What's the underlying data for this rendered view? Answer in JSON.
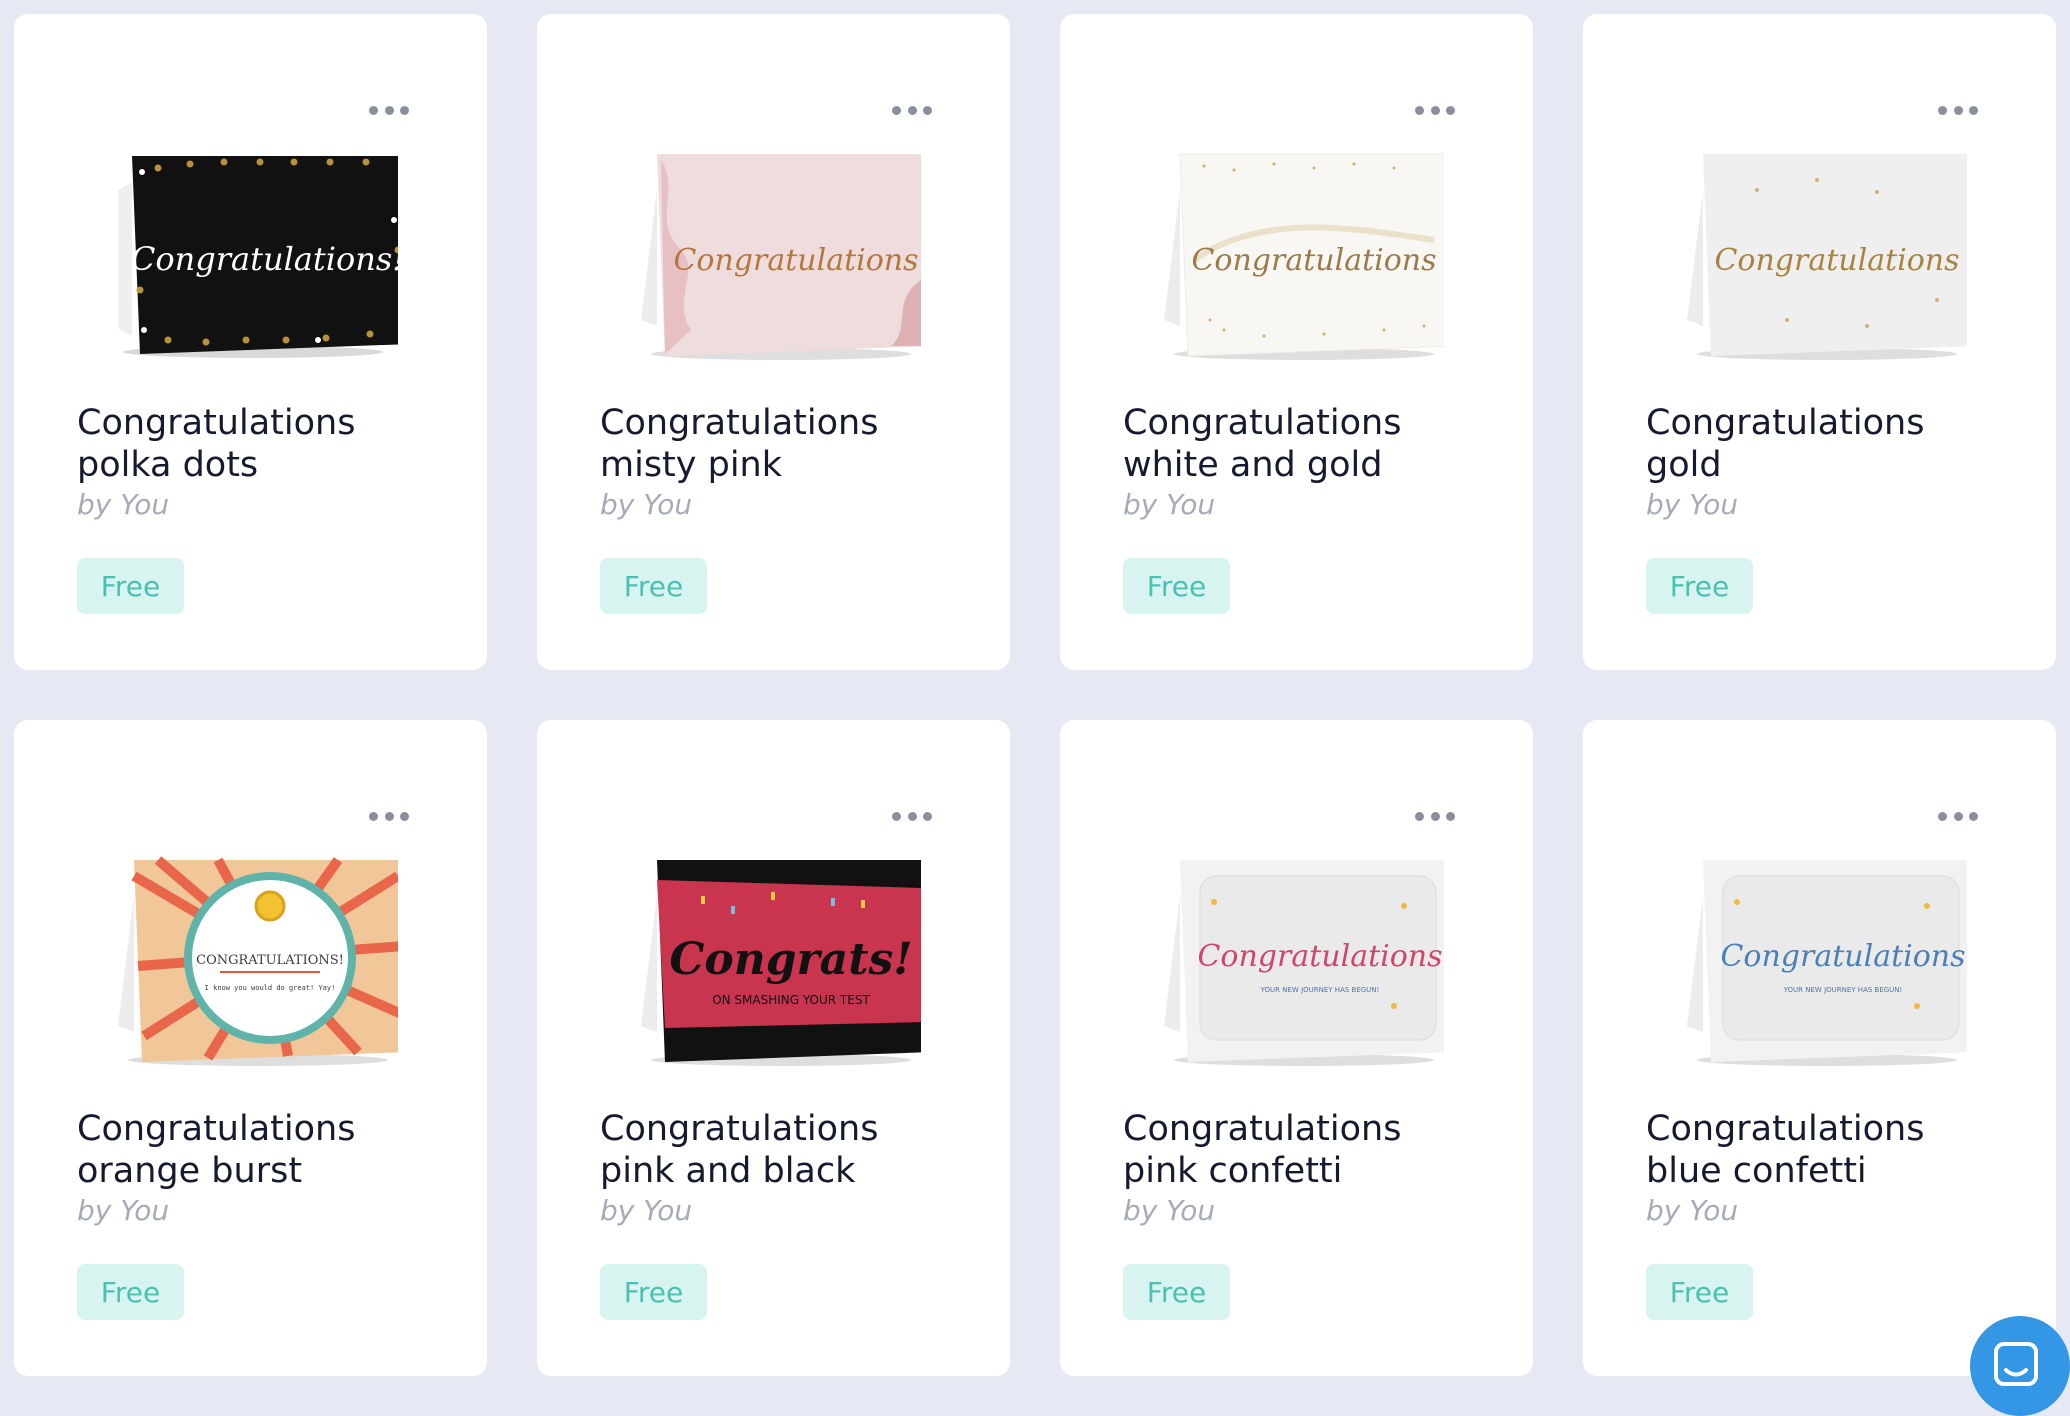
{
  "cards": [
    {
      "title_line1": "Congratulations",
      "title_line2": "polka dots",
      "author": "by You",
      "price": "Free",
      "card_text": "Congratulations!"
    },
    {
      "title_line1": "Congratulations",
      "title_line2": "misty pink",
      "author": "by You",
      "price": "Free",
      "card_text": "Congratulations"
    },
    {
      "title_line1": "Congratulations",
      "title_line2": "white and gold",
      "author": "by You",
      "price": "Free",
      "card_text": "Congratulations"
    },
    {
      "title_line1": "Congratulations",
      "title_line2": "gold",
      "author": "by You",
      "price": "Free",
      "card_text": "Congratulations"
    },
    {
      "title_line1": "Congratulations",
      "title_line2": "orange burst",
      "author": "by You",
      "price": "Free",
      "card_text": "CONGRATULATIONS!",
      "card_subtext": "I know you would do great! Yay!"
    },
    {
      "title_line1": "Congratulations",
      "title_line2": "pink and black",
      "author": "by You",
      "price": "Free",
      "card_text": "Congrats!",
      "card_subtext": "ON SMASHING YOUR TEST"
    },
    {
      "title_line1": "Congratulations",
      "title_line2": "pink confetti",
      "author": "by You",
      "price": "Free",
      "card_text": "Congratulations",
      "card_subtext": "YOUR NEW JOURNEY HAS BEGUN!"
    },
    {
      "title_line1": "Congratulations",
      "title_line2": "blue confetti",
      "author": "by You",
      "price": "Free",
      "card_text": "Congratulations",
      "card_subtext": "YOUR NEW JOURNEY HAS BEGUN!"
    }
  ],
  "icons": {
    "more": "more-horizontal-icon",
    "chat": "chat-bubble-icon"
  },
  "colors": {
    "background": "#e6e9f3",
    "card": "#ffffff",
    "price_bg": "#d8f4f1",
    "price_text": "#4bc0b3",
    "title": "#161a2e",
    "author": "#a7abb7",
    "chat": "#3497e6"
  }
}
